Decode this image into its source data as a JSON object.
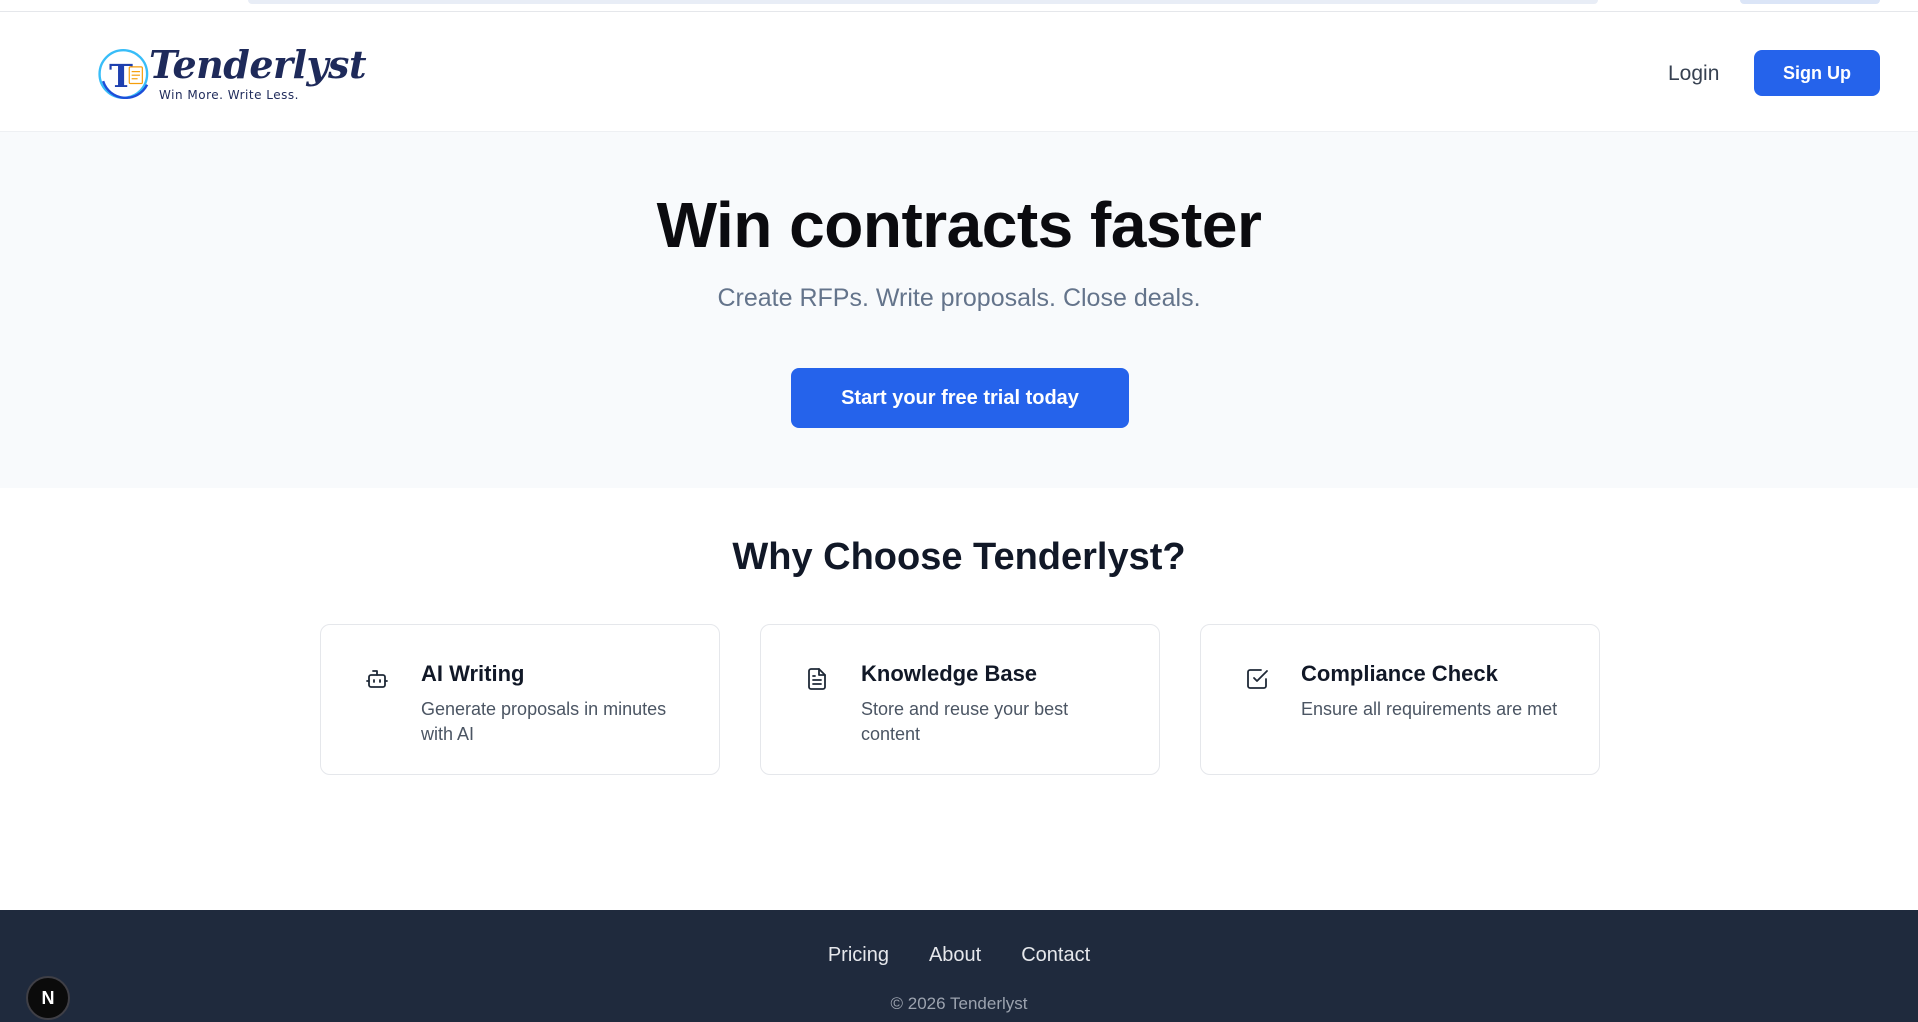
{
  "header": {
    "logo": {
      "name": "Tenderlyst",
      "tagline": "Win More. Write Less."
    },
    "login_label": "Login",
    "signup_label": "Sign Up"
  },
  "hero": {
    "title": "Win contracts faster",
    "subtitle": "Create RFPs. Write proposals. Close deals.",
    "cta_label": "Start your free trial today"
  },
  "features": {
    "title": "Why Choose Tenderlyst?",
    "cards": [
      {
        "icon": "bot-icon",
        "title": "AI Writing",
        "description": "Generate proposals in minutes with AI"
      },
      {
        "icon": "document-icon",
        "title": "Knowledge Base",
        "description": "Store and reuse your best content"
      },
      {
        "icon": "checkbox-icon",
        "title": "Compliance Check",
        "description": "Ensure all requirements are met"
      }
    ]
  },
  "footer": {
    "links": [
      "Pricing",
      "About",
      "Contact"
    ],
    "copyright": "© 2026 Tenderlyst"
  },
  "dev_badge": {
    "label": "N",
    "icon": "nextjs-icon"
  },
  "colors": {
    "primary": "#2563eb",
    "footer_bg": "#1f2a3d",
    "hero_bg": "#f8fafc",
    "logo_navy": "#1e2a5a",
    "logo_blue": "#38bdf8",
    "logo_orange": "#f59e0b"
  }
}
